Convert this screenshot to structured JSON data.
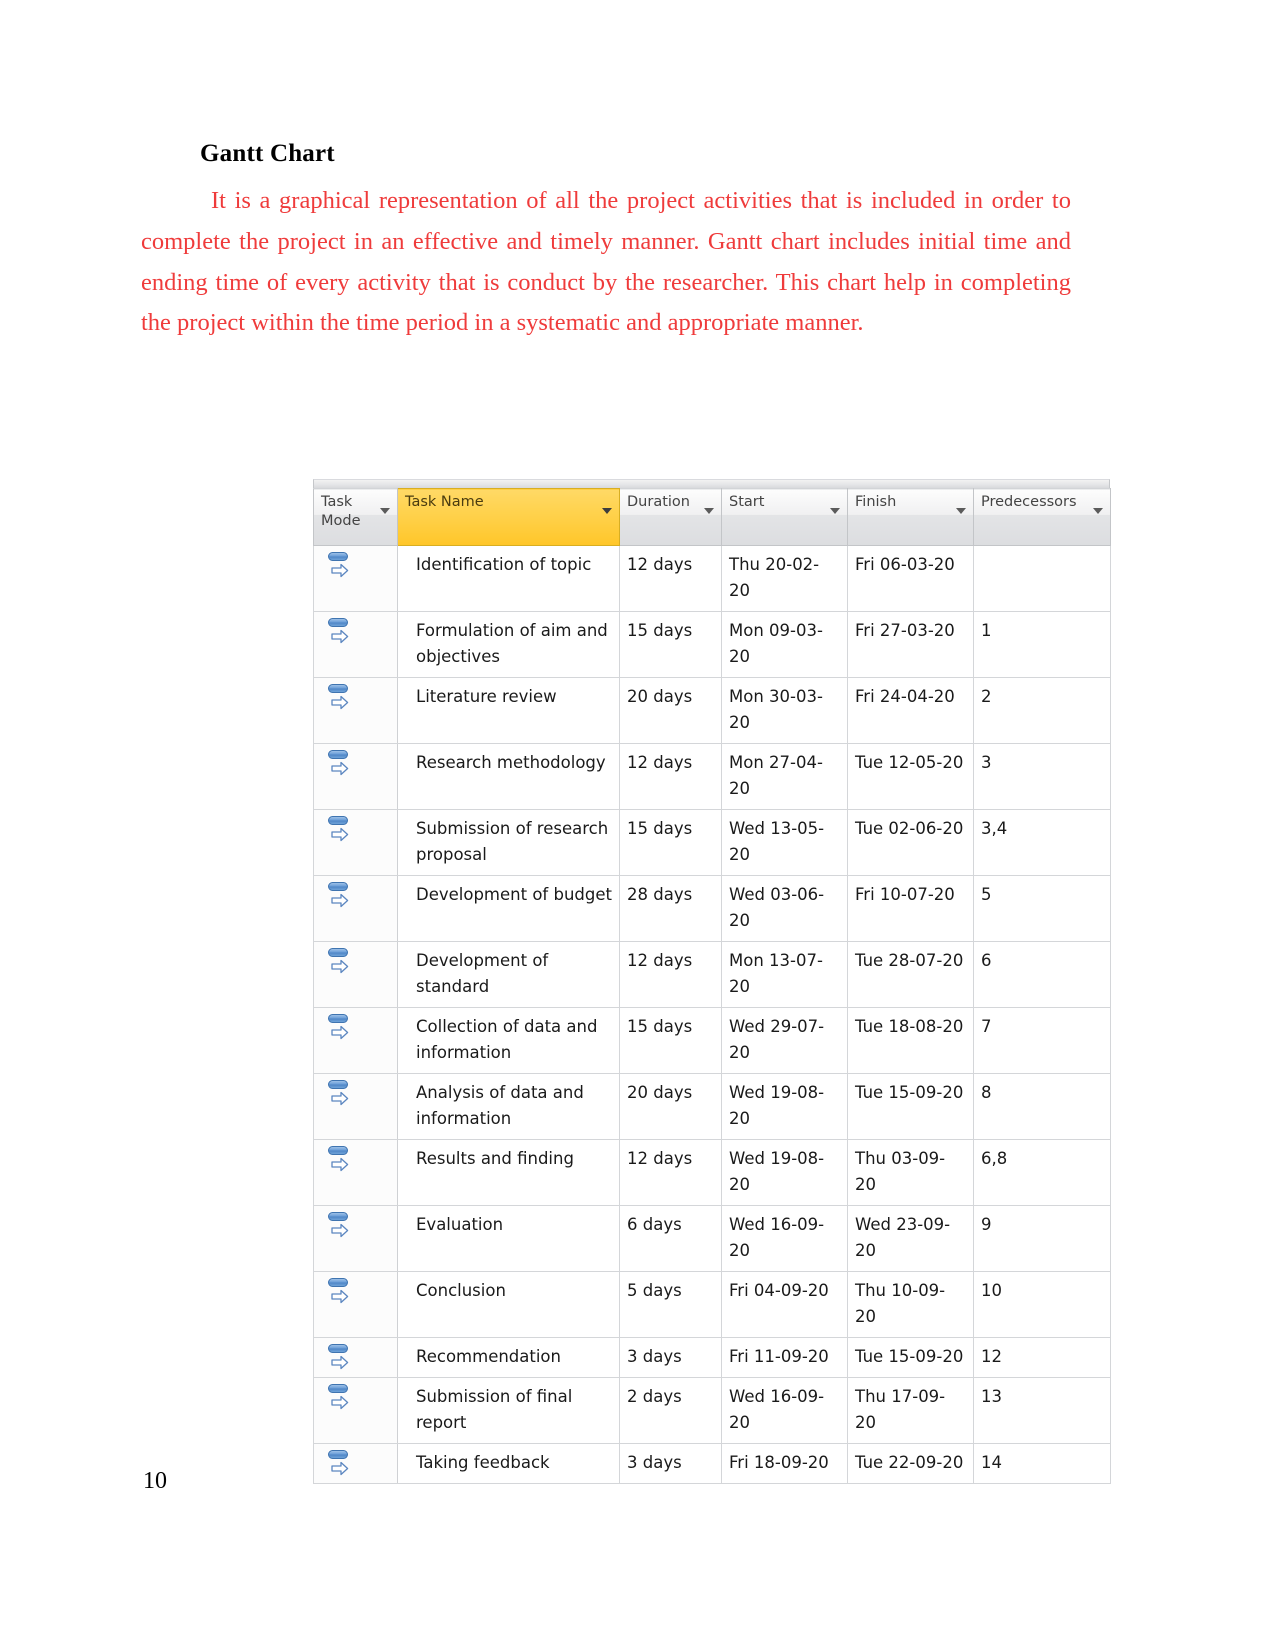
{
  "document": {
    "heading": "Gantt Chart",
    "paragraph": "It is a graphical representation of all the project activities that is included in order to complete the project in an effective and timely manner. Gantt chart includes initial time and ending time of every activity that is conduct by the researcher. This chart help in completing the project within the time period in a systematic and appropriate manner.",
    "page_number": "10",
    "text_color": "#ef3b3b",
    "heading_color": "#000000"
  },
  "chart_data": {
    "type": "table",
    "title": "Gantt Chart",
    "columns": [
      "Task Mode",
      "Task Name",
      "Duration",
      "Start",
      "Finish",
      "Predecessors"
    ],
    "highlight_column": "Task Name",
    "highlight_color": "#ffcf45",
    "rows": [
      {
        "id": 1,
        "mode": "manually-scheduled-icon",
        "name": "Identification of topic",
        "duration": "12 days",
        "start": "Thu 20-02-20",
        "finish": "Fri 06-03-20",
        "predecessors": ""
      },
      {
        "id": 2,
        "mode": "manually-scheduled-icon",
        "name": "Formulation of aim and objectives",
        "duration": "15 days",
        "start": "Mon 09-03-20",
        "finish": "Fri 27-03-20",
        "predecessors": "1"
      },
      {
        "id": 3,
        "mode": "manually-scheduled-icon",
        "name": "Literature review",
        "duration": "20 days",
        "start": "Mon 30-03-20",
        "finish": "Fri 24-04-20",
        "predecessors": "2"
      },
      {
        "id": 4,
        "mode": "manually-scheduled-icon",
        "name": "Research methodology",
        "duration": "12 days",
        "start": "Mon 27-04-20",
        "finish": "Tue 12-05-20",
        "predecessors": "3"
      },
      {
        "id": 5,
        "mode": "manually-scheduled-icon",
        "name": "Submission of research proposal",
        "duration": "15 days",
        "start": "Wed 13-05-20",
        "finish": "Tue 02-06-20",
        "predecessors": "3,4"
      },
      {
        "id": 6,
        "mode": "manually-scheduled-icon",
        "name": "Development of budget",
        "duration": "28 days",
        "start": "Wed 03-06-20",
        "finish": "Fri 10-07-20",
        "predecessors": "5"
      },
      {
        "id": 7,
        "mode": "manually-scheduled-icon",
        "name": "Development of standard",
        "duration": "12 days",
        "start": "Mon 13-07-20",
        "finish": "Tue 28-07-20",
        "predecessors": "6"
      },
      {
        "id": 8,
        "mode": "manually-scheduled-icon",
        "name": "Collection of data and information",
        "duration": "15 days",
        "start": "Wed 29-07-20",
        "finish": "Tue 18-08-20",
        "predecessors": "7"
      },
      {
        "id": 9,
        "mode": "manually-scheduled-icon",
        "name": "Analysis of data and information",
        "duration": "20 days",
        "start": "Wed 19-08-20",
        "finish": "Tue 15-09-20",
        "predecessors": "8"
      },
      {
        "id": 10,
        "mode": "manually-scheduled-icon",
        "name": "Results and finding",
        "duration": "12 days",
        "start": "Wed 19-08-20",
        "finish": "Thu 03-09-20",
        "predecessors": "6,8"
      },
      {
        "id": 11,
        "mode": "manually-scheduled-icon",
        "name": "Evaluation",
        "duration": "6 days",
        "start": "Wed 16-09-20",
        "finish": "Wed 23-09-20",
        "predecessors": "9"
      },
      {
        "id": 12,
        "mode": "manually-scheduled-icon",
        "name": "Conclusion",
        "duration": "5 days",
        "start": "Fri 04-09-20",
        "finish": "Thu 10-09-20",
        "predecessors": "10"
      },
      {
        "id": 13,
        "mode": "manually-scheduled-icon",
        "name": "Recommendation",
        "duration": "3 days",
        "start": "Fri 11-09-20",
        "finish": "Tue 15-09-20",
        "predecessors": "12"
      },
      {
        "id": 14,
        "mode": "manually-scheduled-icon",
        "name": "Submission of final report",
        "duration": "2 days",
        "start": "Wed 16-09-20",
        "finish": "Thu 17-09-20",
        "predecessors": "13"
      },
      {
        "id": 15,
        "mode": "manually-scheduled-icon",
        "name": "Taking feedback",
        "duration": "3 days",
        "start": "Fri 18-09-20",
        "finish": "Tue 22-09-20",
        "predecessors": "14"
      }
    ]
  }
}
